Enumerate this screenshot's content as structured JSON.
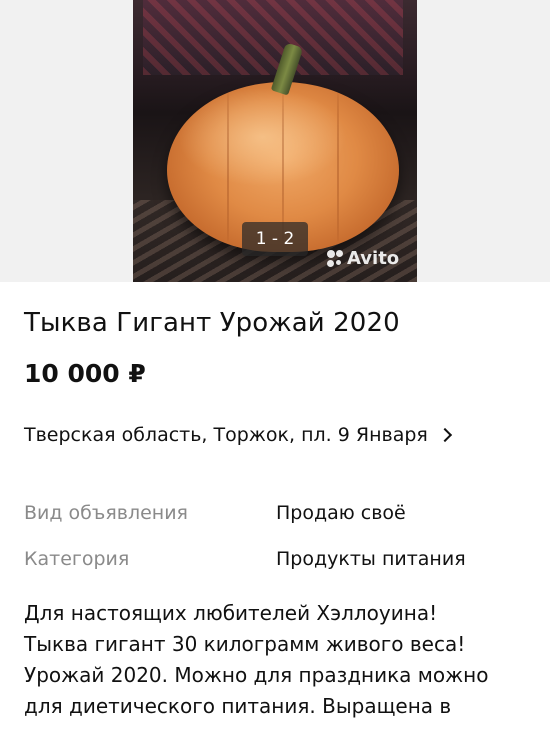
{
  "gallery": {
    "counter": "1 - 2",
    "watermark": "Avito"
  },
  "listing": {
    "title": "Тыква Гигант Урожай 2020",
    "price": "10 000 ₽",
    "address": "Тверская область, Торжок, пл. 9 Января"
  },
  "params": [
    {
      "label": "Вид объявления",
      "value": "Продаю своё"
    },
    {
      "label": "Категория",
      "value": "Продукты питания"
    }
  ],
  "description": [
    "Для настоящих любителей Хэллоуина!",
    "Тыква гигант 30 килограмм живого веса!",
    "Урожай 2020. Можно для праздника можно",
    "для диетического питания. Выращена в"
  ]
}
